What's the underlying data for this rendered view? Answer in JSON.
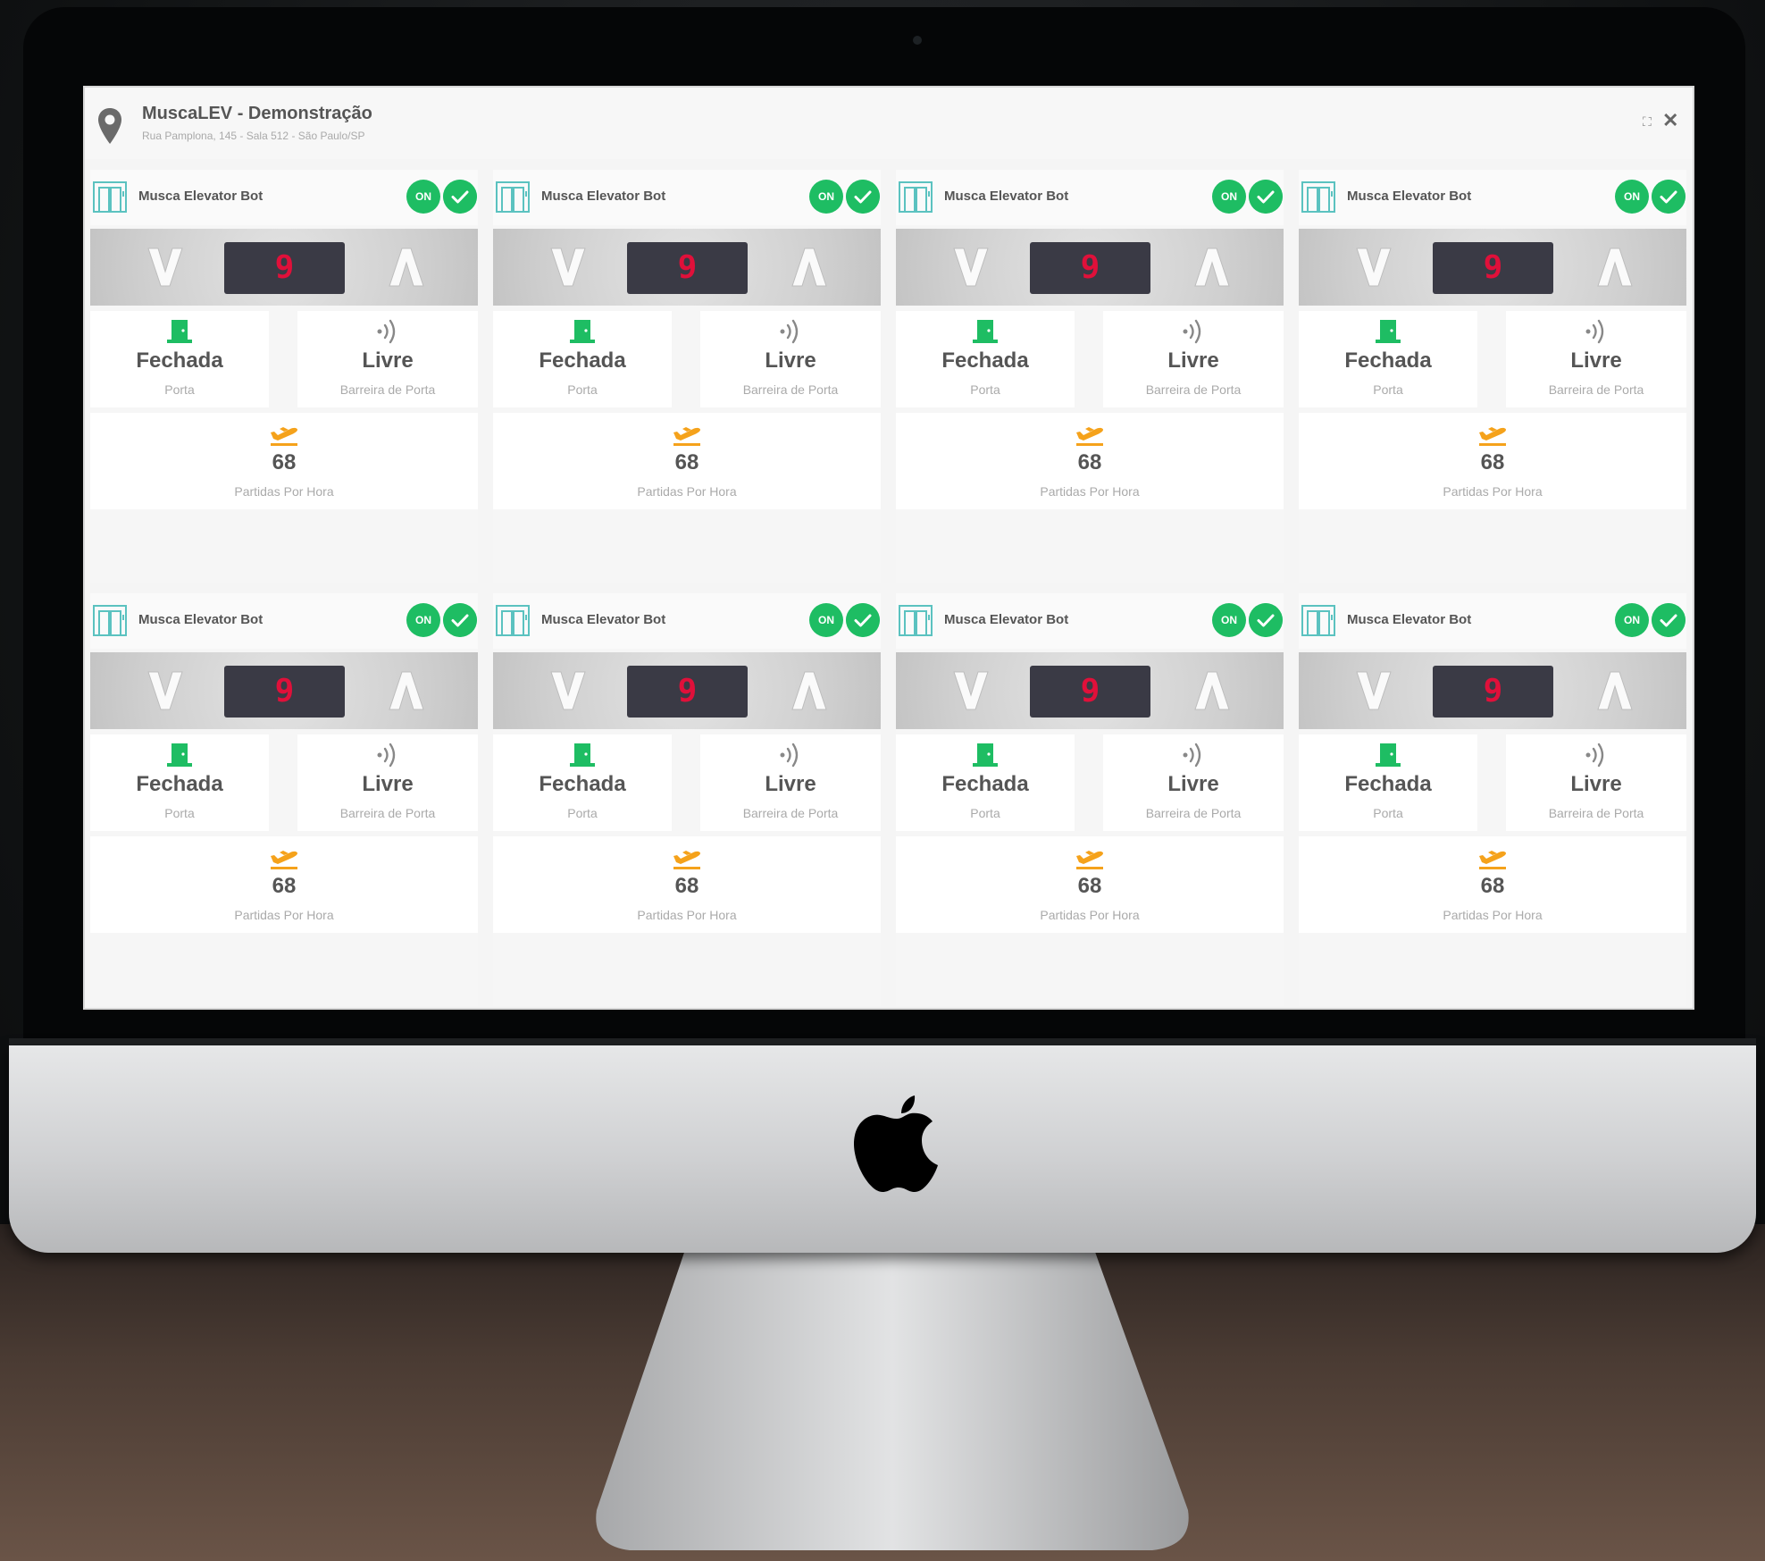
{
  "header": {
    "site_name": "MuscaLEV - Demonstração",
    "site_address": "Rua Pamplona, 145 - Sala 512 - São Paulo/SP",
    "expand_glyph": "⛶",
    "close_glyph": "✕"
  },
  "colors": {
    "status_green": "#1ebd63",
    "floor_digit_red": "#e0103a",
    "trips_icon_orange": "#f5a21b",
    "elevator_icon_teal": "#5bc2c0"
  },
  "cards": [
    {
      "title": "Musca Elevator Bot",
      "status": "ON",
      "floor": "9",
      "door_value": "Fechada",
      "door_label": "Porta",
      "barrier_value": "Livre",
      "barrier_label": "Barreira de Porta",
      "trips_value": "68",
      "trips_label": "Partidas Por Hora"
    },
    {
      "title": "Musca Elevator Bot",
      "status": "ON",
      "floor": "9",
      "door_value": "Fechada",
      "door_label": "Porta",
      "barrier_value": "Livre",
      "barrier_label": "Barreira de Porta",
      "trips_value": "68",
      "trips_label": "Partidas Por Hora"
    },
    {
      "title": "Musca Elevator Bot",
      "status": "ON",
      "floor": "9",
      "door_value": "Fechada",
      "door_label": "Porta",
      "barrier_value": "Livre",
      "barrier_label": "Barreira de Porta",
      "trips_value": "68",
      "trips_label": "Partidas Por Hora"
    },
    {
      "title": "Musca Elevator Bot",
      "status": "ON",
      "floor": "9",
      "door_value": "Fechada",
      "door_label": "Porta",
      "barrier_value": "Livre",
      "barrier_label": "Barreira de Porta",
      "trips_value": "68",
      "trips_label": "Partidas Por Hora"
    },
    {
      "title": "Musca Elevator Bot",
      "status": "ON",
      "floor": "9",
      "door_value": "Fechada",
      "door_label": "Porta",
      "barrier_value": "Livre",
      "barrier_label": "Barreira de Porta",
      "trips_value": "68",
      "trips_label": "Partidas Por Hora"
    },
    {
      "title": "Musca Elevator Bot",
      "status": "ON",
      "floor": "9",
      "door_value": "Fechada",
      "door_label": "Porta",
      "barrier_value": "Livre",
      "barrier_label": "Barreira de Porta",
      "trips_value": "68",
      "trips_label": "Partidas Por Hora"
    },
    {
      "title": "Musca Elevator Bot",
      "status": "ON",
      "floor": "9",
      "door_value": "Fechada",
      "door_label": "Porta",
      "barrier_value": "Livre",
      "barrier_label": "Barreira de Porta",
      "trips_value": "68",
      "trips_label": "Partidas Por Hora"
    },
    {
      "title": "Musca Elevator Bot",
      "status": "ON",
      "floor": "9",
      "door_value": "Fechada",
      "door_label": "Porta",
      "barrier_value": "Livre",
      "barrier_label": "Barreira de Porta",
      "trips_value": "68",
      "trips_label": "Partidas Por Hora"
    }
  ]
}
